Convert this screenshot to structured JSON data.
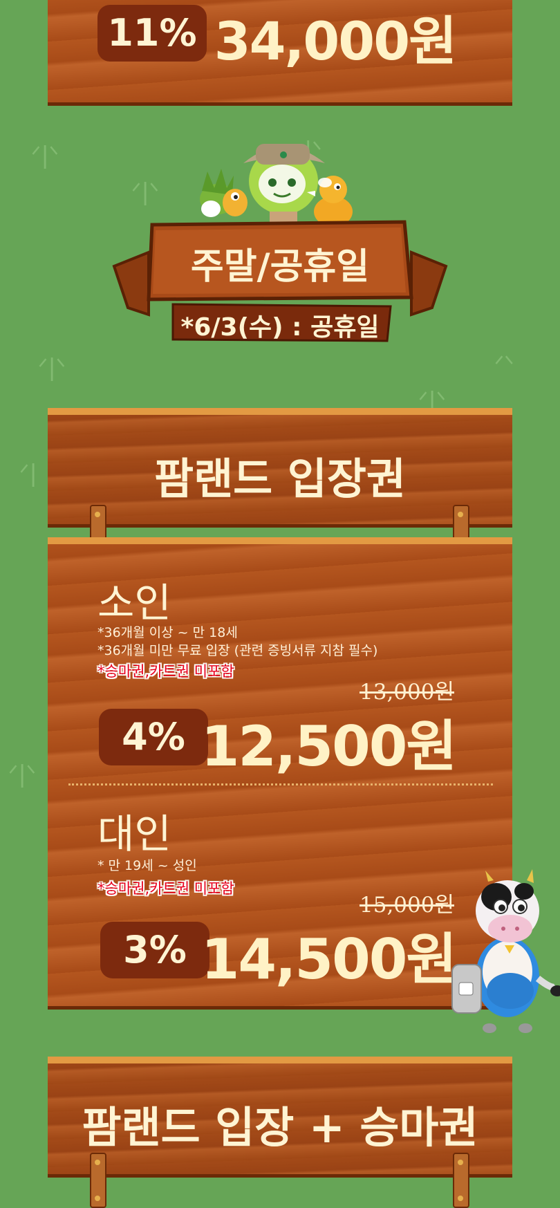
{
  "top_price": {
    "discount": "11%",
    "price": "34,000원"
  },
  "weekend": {
    "title": "주말/공휴일",
    "note": "*6/3(수) : 공휴일"
  },
  "section1": {
    "title": "팜랜드 입장권",
    "child": {
      "label": "소인",
      "note1": "*36개월 이상 ~ 만 18세",
      "note2": "*36개월 미만 무료 입장 (관련 증빙서류 지참 필수)",
      "warn": "*승마권,카트권 미포함",
      "original": "13,000원",
      "discount": "4%",
      "price": "12,500원"
    },
    "adult": {
      "label": "대인",
      "note1": "* 만 19세 ~ 성인",
      "warn": "*승마권,카트권 미포함",
      "original": "15,000원",
      "discount": "3%",
      "price": "14,500원"
    }
  },
  "section2": {
    "title": "팜랜드 입장 + 승마권"
  },
  "colors": {
    "background": "#66a556",
    "wood": "#a34a18",
    "badge": "#7d2a0e",
    "cream": "#fff4d3",
    "warn": "#e8001e"
  },
  "icons": [
    "grass-icon",
    "cow-mascot",
    "character-group"
  ]
}
